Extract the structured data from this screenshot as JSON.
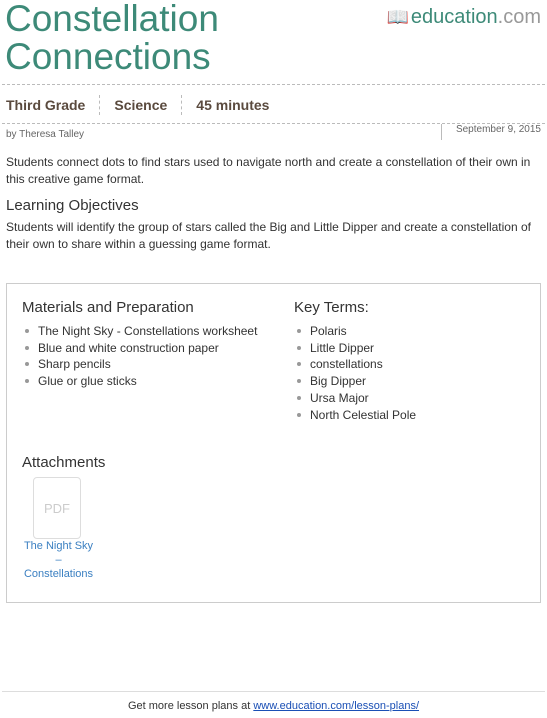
{
  "title_line1": "Constellation",
  "title_line2": "Connections",
  "logo": {
    "main": "education",
    ".com": ".com"
  },
  "meta": [
    "Third Grade",
    "Science",
    "45 minutes"
  ],
  "author": "by Theresa Talley",
  "date": "September 9, 2015",
  "description": "Students connect dots to find stars used to navigate north and create a constellation of their own in this creative game format.",
  "objectives": {
    "heading": "Learning Objectives",
    "text": "Students will identify the group of stars called the Big and Little Dipper and create a constellation of their own to share within a guessing game format."
  },
  "materials": {
    "heading": "Materials and Preparation",
    "items": [
      "The Night Sky - Constellations worksheet",
      "Blue and white construction paper",
      "Sharp pencils",
      "Glue or glue sticks"
    ]
  },
  "key_terms": {
    "heading": "Key Terms:",
    "items": [
      "Polaris",
      "Little Dipper",
      "constellations",
      "Big Dipper",
      "Ursa Major",
      "North Celestial Pole"
    ]
  },
  "attachments": {
    "heading": "Attachments",
    "file_type": "PDF",
    "link_line1": "The Night Sky",
    "link_line2": "–",
    "link_line3": "Constellations"
  },
  "footer": {
    "text": "Get more lesson plans at ",
    "link": "www.education.com/lesson-plans/"
  }
}
